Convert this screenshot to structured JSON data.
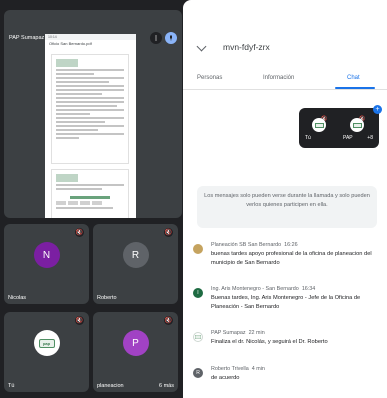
{
  "presentation": {
    "presenter_name": "PAP Sumapaz",
    "doc_name": "Oficio San Bernardo.pdf",
    "phone_time": "10:14"
  },
  "tiles": [
    {
      "name": "Nicolas",
      "initial": "N",
      "color": "#7b1fa2",
      "right_text": ""
    },
    {
      "name": "Roberto",
      "initial": "R",
      "color": "#5f6368",
      "right_text": ""
    },
    {
      "name": "Tú",
      "initial": "",
      "color": "#ffffff",
      "right_text": ""
    },
    {
      "name": "planeacion",
      "initial": "P",
      "color": "#a142c4",
      "right_text": "6 más"
    }
  ],
  "panel": {
    "meeting_code": "mvn-fdyf-zrx",
    "tabs": [
      "Personas",
      "Información",
      "Chat"
    ],
    "active_tab": "Chat",
    "pip": {
      "self_label": "Tú",
      "other_label": "PAP",
      "more_count": "+8"
    },
    "notice": "Los mensajes solo pueden verse durante la llamada y solo pueden verlos quienes participen en ella."
  },
  "messages": [
    {
      "sender": "Planeación SB San Bernardo",
      "time": "16:26",
      "text": "buenas tardes apoyo profesional de la oficina de planeacion del municipio de San Bernardo",
      "avatar_color": "#c5a35f",
      "avatar_initial": ""
    },
    {
      "sender": "Ing. Aris Montenegro - San Bernardo",
      "time": "16:34",
      "text": "Buenas tardes, Ing. Aris Montenegro - Jefe de la Oficina de Planeación - San Bernardo",
      "avatar_color": "#1e6b42",
      "avatar_initial": "I"
    },
    {
      "sender": "PAP Sumapaz",
      "time": "22 min",
      "text": "Finaliza el dr. Nicolás, y seguirá el Dr. Roberto",
      "avatar_color": "#ffffff",
      "avatar_initial": ""
    },
    {
      "sender": "Roberto Trivella",
      "time": "4 min",
      "text": "de acuerdo",
      "avatar_color": "#5f6368",
      "avatar_initial": "R"
    }
  ]
}
